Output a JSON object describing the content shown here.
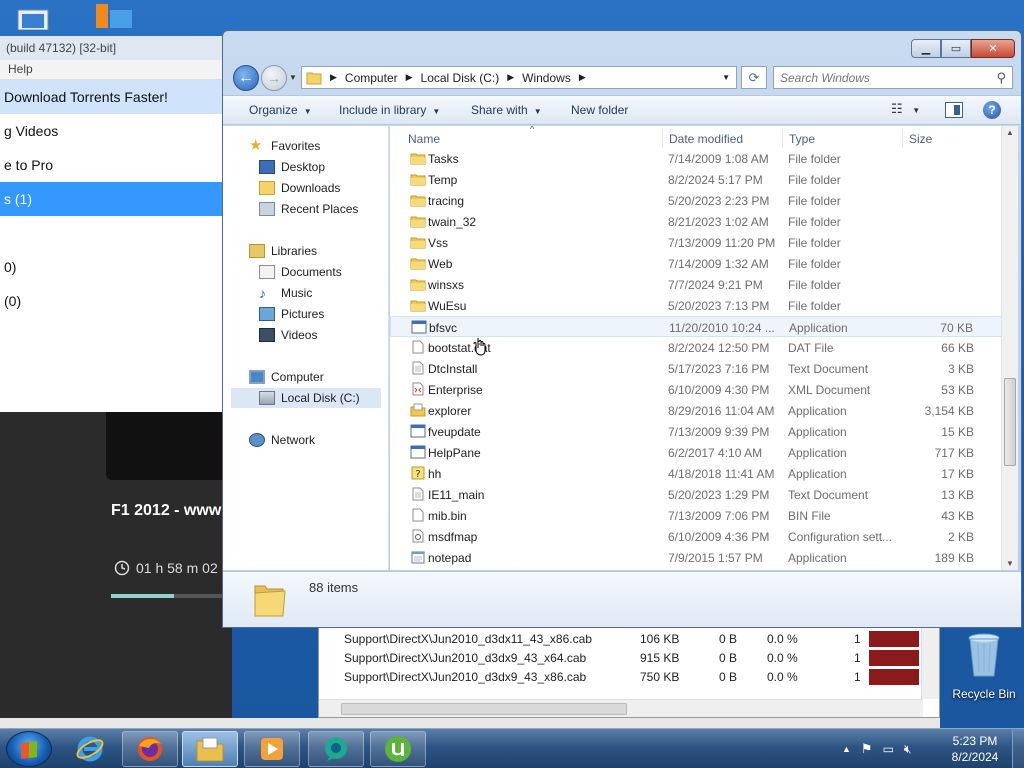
{
  "background_app": {
    "title": "(build 47132) [32-bit]",
    "menu": "Help",
    "rows": [
      {
        "label": "Download Torrents Faster!",
        "state": "highlight"
      },
      {
        "label": "g Videos",
        "state": "normal"
      },
      {
        "label": "e to Pro",
        "state": "normal"
      },
      {
        "label": "s (1)",
        "state": "selected"
      },
      {
        "label": "",
        "state": "normal"
      },
      {
        "label": "0)",
        "state": "normal"
      },
      {
        "label": "(0)",
        "state": "normal"
      }
    ],
    "media_title": "F1 2012 - www",
    "media_time": "01 h  58 m  02",
    "media_progress": 0.52
  },
  "files_panel": {
    "rows": [
      {
        "path": "Support\\DirectX\\Jun2010_d3dx11_43_x86.cab",
        "size": "106 KB",
        "done": "0 B",
        "pct": "0.0 %",
        "priority": "1"
      },
      {
        "path": "Support\\DirectX\\Jun2010_d3dx9_43_x64.cab",
        "size": "915 KB",
        "done": "0 B",
        "pct": "0.0 %",
        "priority": "1"
      },
      {
        "path": "Support\\DirectX\\Jun2010_d3dx9_43_x86.cab",
        "size": "750 KB",
        "done": "0 B",
        "pct": "0.0 %",
        "priority": "1"
      }
    ]
  },
  "explorer": {
    "address": [
      "Computer",
      "Local Disk (C:)",
      "Windows"
    ],
    "search_placeholder": "Search Windows",
    "toolbar": {
      "organize": "Organize",
      "include": "Include in library",
      "share": "Share with",
      "new_folder": "New folder"
    },
    "nav": {
      "favorites": "Favorites",
      "desktop": "Desktop",
      "downloads": "Downloads",
      "recent": "Recent Places",
      "libraries": "Libraries",
      "documents": "Documents",
      "music": "Music",
      "pictures": "Pictures",
      "videos": "Videos",
      "computer": "Computer",
      "local_disk": "Local Disk (C:)",
      "network": "Network"
    },
    "columns": {
      "name": "Name",
      "date": "Date modified",
      "type": "Type",
      "size": "Size"
    },
    "files": [
      {
        "name": "Tasks",
        "date": "7/14/2009 1:08 AM",
        "type": "File folder",
        "size": "",
        "icon": "folder"
      },
      {
        "name": "Temp",
        "date": "8/2/2024 5:17 PM",
        "type": "File folder",
        "size": "",
        "icon": "folder"
      },
      {
        "name": "tracing",
        "date": "5/20/2023 2:23 PM",
        "type": "File folder",
        "size": "",
        "icon": "folder"
      },
      {
        "name": "twain_32",
        "date": "8/21/2023 1:02 AM",
        "type": "File folder",
        "size": "",
        "icon": "folder"
      },
      {
        "name": "Vss",
        "date": "7/13/2009 11:20 PM",
        "type": "File folder",
        "size": "",
        "icon": "folder"
      },
      {
        "name": "Web",
        "date": "7/14/2009 1:32 AM",
        "type": "File folder",
        "size": "",
        "icon": "folder"
      },
      {
        "name": "winsxs",
        "date": "7/7/2024 9:21 PM",
        "type": "File folder",
        "size": "",
        "icon": "folder"
      },
      {
        "name": "WuEsu",
        "date": "5/20/2023 7:13 PM",
        "type": "File folder",
        "size": "",
        "icon": "folder"
      },
      {
        "name": "bfsvc",
        "date": "11/20/2010 10:24 ...",
        "type": "Application",
        "size": "70 KB",
        "icon": "app"
      },
      {
        "name": "bootstat.dat",
        "date": "8/2/2024 12:50 PM",
        "type": "DAT File",
        "size": "66 KB",
        "icon": "file"
      },
      {
        "name": "DtcInstall",
        "date": "5/17/2023 7:16 PM",
        "type": "Text Document",
        "size": "3 KB",
        "icon": "text"
      },
      {
        "name": "Enterprise",
        "date": "6/10/2009 4:30 PM",
        "type": "XML Document",
        "size": "53 KB",
        "icon": "xml"
      },
      {
        "name": "explorer",
        "date": "8/29/2016 11:04 AM",
        "type": "Application",
        "size": "3,154 KB",
        "icon": "explorer"
      },
      {
        "name": "fveupdate",
        "date": "7/13/2009 9:39 PM",
        "type": "Application",
        "size": "15 KB",
        "icon": "app"
      },
      {
        "name": "HelpPane",
        "date": "6/2/2017 4:10 AM",
        "type": "Application",
        "size": "717 KB",
        "icon": "app"
      },
      {
        "name": "hh",
        "date": "4/18/2018 11:41 AM",
        "type": "Application",
        "size": "17 KB",
        "icon": "help"
      },
      {
        "name": "IE11_main",
        "date": "5/20/2023 1:29 PM",
        "type": "Text Document",
        "size": "13 KB",
        "icon": "text"
      },
      {
        "name": "mib.bin",
        "date": "7/13/2009 7:06 PM",
        "type": "BIN File",
        "size": "43 KB",
        "icon": "file"
      },
      {
        "name": "msdfmap",
        "date": "6/10/2009 4:36 PM",
        "type": "Configuration sett...",
        "size": "2 KB",
        "icon": "config"
      },
      {
        "name": "notepad",
        "date": "7/9/2015 1:57 PM",
        "type": "Application",
        "size": "189 KB",
        "icon": "notepad"
      }
    ],
    "item_count": "88 items"
  },
  "desktop": {
    "recycle_bin": "Recycle Bin"
  },
  "taskbar": {
    "time": "5:23 PM",
    "date": "8/2/2024"
  }
}
